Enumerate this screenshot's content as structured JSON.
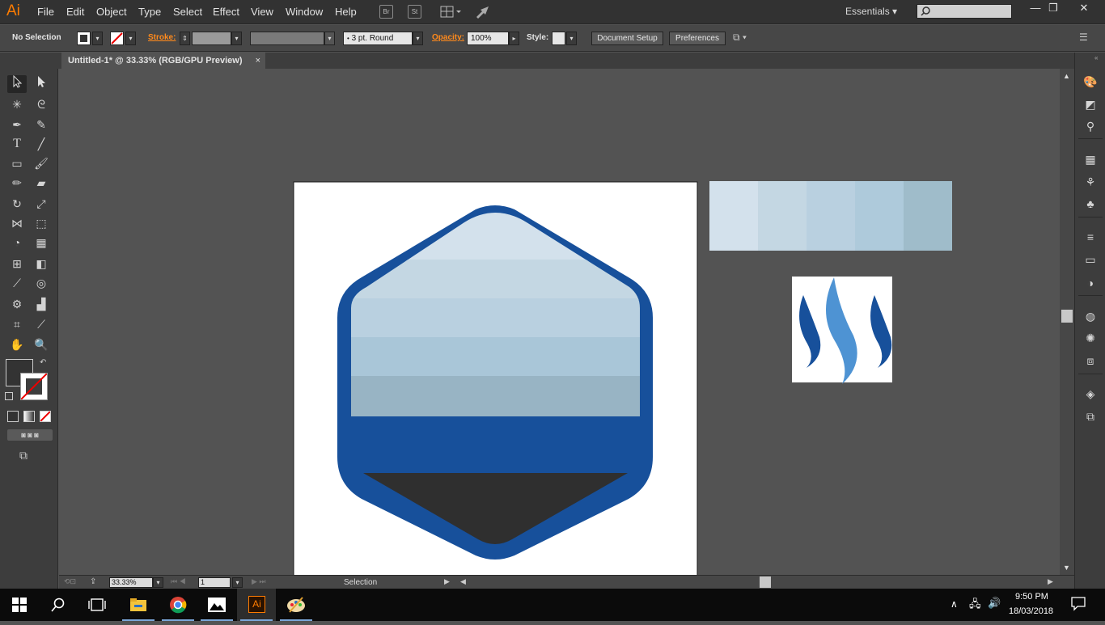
{
  "app": {
    "logo": "Ai",
    "menus": [
      "File",
      "Edit",
      "Object",
      "Type",
      "Select",
      "Effect",
      "View",
      "Window",
      "Help"
    ],
    "toolbar_icons": [
      "Br",
      "St"
    ],
    "workspace": "Essentials",
    "window_controls": {
      "minimize": "—",
      "restore": "❐",
      "close": "✕"
    }
  },
  "control_bar": {
    "selection_label": "No Selection",
    "stroke_label": "Stroke:",
    "brush_value": "3 pt. Round",
    "opacity_label": "Opacity:",
    "opacity_value": "100%",
    "style_label": "Style:",
    "document_setup": "Document Setup",
    "preferences": "Preferences"
  },
  "document_tab": {
    "title": "Untitled-1* @ 33.33% (RGB/GPU Preview)",
    "close": "×"
  },
  "status_bar": {
    "zoom": "33.33%",
    "page": "1",
    "tool_name": "Selection"
  },
  "artwork": {
    "hex_border_color": "#17509b",
    "stripe_colors": [
      "#d3e1ec",
      "#c4d7e3",
      "#b9d0e0",
      "#a9c6d8",
      "#98b4c4"
    ],
    "band_color": "#17509b",
    "bottom_fill_color": "#2f2f2f",
    "swatch_colors": [
      "#d3e1ec",
      "#c4d7e3",
      "#b9d0e0",
      "#aecadb",
      "#9fbcca"
    ],
    "logo_colors": {
      "dark": "#17509b",
      "light": "#4e93d3"
    }
  },
  "taskbar": {
    "time": "9:50 PM",
    "date": "18/03/2018",
    "apps": [
      "start-icon",
      "search-icon",
      "task-view-icon",
      "file-explorer-icon",
      "chrome-icon",
      "photos-icon",
      "illustrator-icon",
      "paint-icon"
    ],
    "illustrator_label": "Ai"
  }
}
